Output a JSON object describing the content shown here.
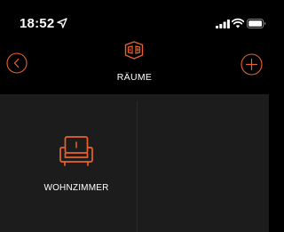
{
  "status_bar": {
    "time": "18:52",
    "icons": [
      "location-arrow-icon",
      "cellular-signal-icon",
      "wifi-icon",
      "battery-icon"
    ]
  },
  "header": {
    "title": "RÄUME",
    "back_icon": "chevron-left-circle-icon",
    "add_icon": "plus-circle-icon",
    "title_icon": "rooms-floorplan-icon"
  },
  "rooms": [
    {
      "label": "WOHNZIMMER",
      "icon": "sofa-icon"
    }
  ],
  "colors": {
    "accent": "#e8622c",
    "background": "#000000",
    "tile_background": "#1c1c1c",
    "text": "#ffffff"
  }
}
